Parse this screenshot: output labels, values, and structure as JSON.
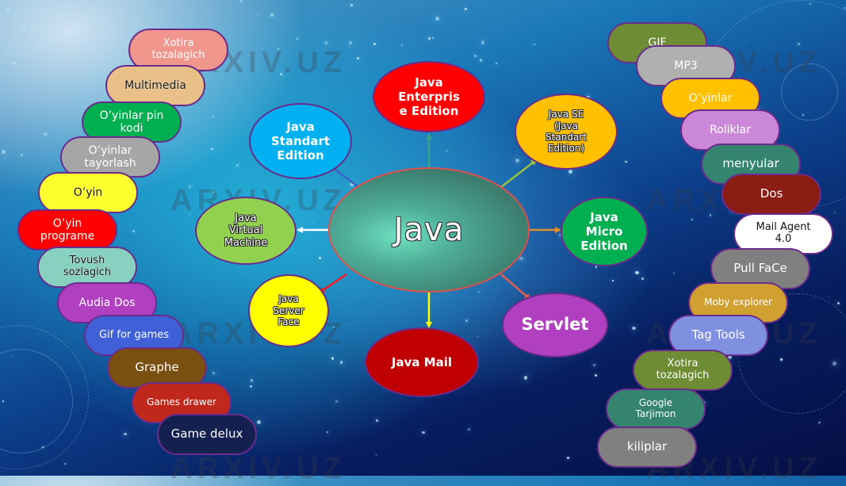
{
  "diagram": {
    "center": {
      "label": "Java",
      "color": "#4f9e88"
    },
    "nodes": [
      {
        "id": "java-ee",
        "label": "Java Enterprise Edition",
        "lines": [
          "Java",
          "Enterpris",
          "e Edition"
        ],
        "color": "#ff0000"
      },
      {
        "id": "java-se-standart",
        "label": "Java Standart Edition",
        "lines": [
          "Java",
          "Standart",
          "Edition"
        ],
        "color": "#00b0f0"
      },
      {
        "id": "java-se",
        "label": "Java SE (Java Standart Edition)",
        "lines": [
          "Java SE",
          "(Java",
          "Standart",
          "Edition)"
        ],
        "color": "#ffc000"
      },
      {
        "id": "jvm",
        "label": "Java Virtual Machine",
        "lines": [
          "Java",
          "Virtual",
          "Machine"
        ],
        "color": "#92d050"
      },
      {
        "id": "java-me",
        "label": "Java Micro Edition",
        "lines": [
          "Java",
          "Micro",
          "Edition"
        ],
        "color": "#00b050"
      },
      {
        "id": "jsf",
        "label": "Java Server Face",
        "lines": [
          "Java",
          "Server",
          "Face"
        ],
        "color": "#ffff00"
      },
      {
        "id": "java-mail",
        "label": "Java Mail",
        "lines": [
          "Java Mail"
        ],
        "color": "#c00000"
      },
      {
        "id": "servlet",
        "label": "Servlet",
        "lines": [
          "Servlet"
        ],
        "color": "#b040c0"
      }
    ],
    "connector_colors": {
      "java-ee": "#3aa08a",
      "java-se-standart": "#3a64c8",
      "java-se": "#9ac040",
      "jvm": "#ffffff",
      "java-me": "#e0902a",
      "jsf": "#ff1a1a",
      "java-mail": "#ffff00",
      "servlet": "#e06050"
    },
    "left_pills": [
      {
        "lines": [
          "Xotira",
          "tozalagich"
        ],
        "color": "#f0968c"
      },
      {
        "lines": [
          "Multimedia"
        ],
        "color": "#e8c088",
        "dark": true
      },
      {
        "lines": [
          "O’yinlar pin",
          "kodi"
        ],
        "color": "#00b050"
      },
      {
        "lines": [
          "O’yinlar",
          "tayorlash"
        ],
        "color": "#a6a6a6"
      },
      {
        "lines": [
          "O’yin"
        ],
        "color": "#ffff30",
        "dark": true
      },
      {
        "lines": [
          "O’yin",
          "programe"
        ],
        "color": "#ff0000"
      },
      {
        "lines": [
          "Tovush",
          "sozlagich"
        ],
        "color": "#88d0c0",
        "dark": true
      },
      {
        "lines": [
          "Audia Dos"
        ],
        "color": "#b040c0"
      },
      {
        "lines": [
          "Gif for games"
        ],
        "color": "#4060d8"
      },
      {
        "lines": [
          "Graphe"
        ],
        "color": "#7a5010"
      },
      {
        "lines": [
          "Games drawer"
        ],
        "color": "#c0281c"
      },
      {
        "lines": [
          "Game delux"
        ],
        "color": "#142050"
      }
    ],
    "right_pills": [
      {
        "lines": [
          "GIF"
        ],
        "color": "#6e8c34"
      },
      {
        "lines": [
          "MP3"
        ],
        "color": "#b0b0b0"
      },
      {
        "lines": [
          "O’yinlar"
        ],
        "color": "#ffc000"
      },
      {
        "lines": [
          "Roliklar"
        ],
        "color": "#cc88d8"
      },
      {
        "lines": [
          "menyular"
        ],
        "color": "#348470"
      },
      {
        "lines": [
          "Dos"
        ],
        "color": "#8a1c14"
      },
      {
        "lines": [
          "Mail Agent",
          "4.0"
        ],
        "color": "#ffffff",
        "dark": true
      },
      {
        "lines": [
          "Pull FaCe"
        ],
        "color": "#808080"
      },
      {
        "lines": [
          "Moby explorer"
        ],
        "color": "#d0a030"
      },
      {
        "lines": [
          "Tag Tools"
        ],
        "color": "#8090e0"
      },
      {
        "lines": [
          "Xotira",
          "tozalagich"
        ],
        "color": "#6e8c34"
      },
      {
        "lines": [
          "Google",
          "Tarjimon"
        ],
        "color": "#348470"
      },
      {
        "lines": [
          "kiliplar"
        ],
        "color": "#808080"
      }
    ],
    "watermark": "ARXIV.UZ"
  }
}
